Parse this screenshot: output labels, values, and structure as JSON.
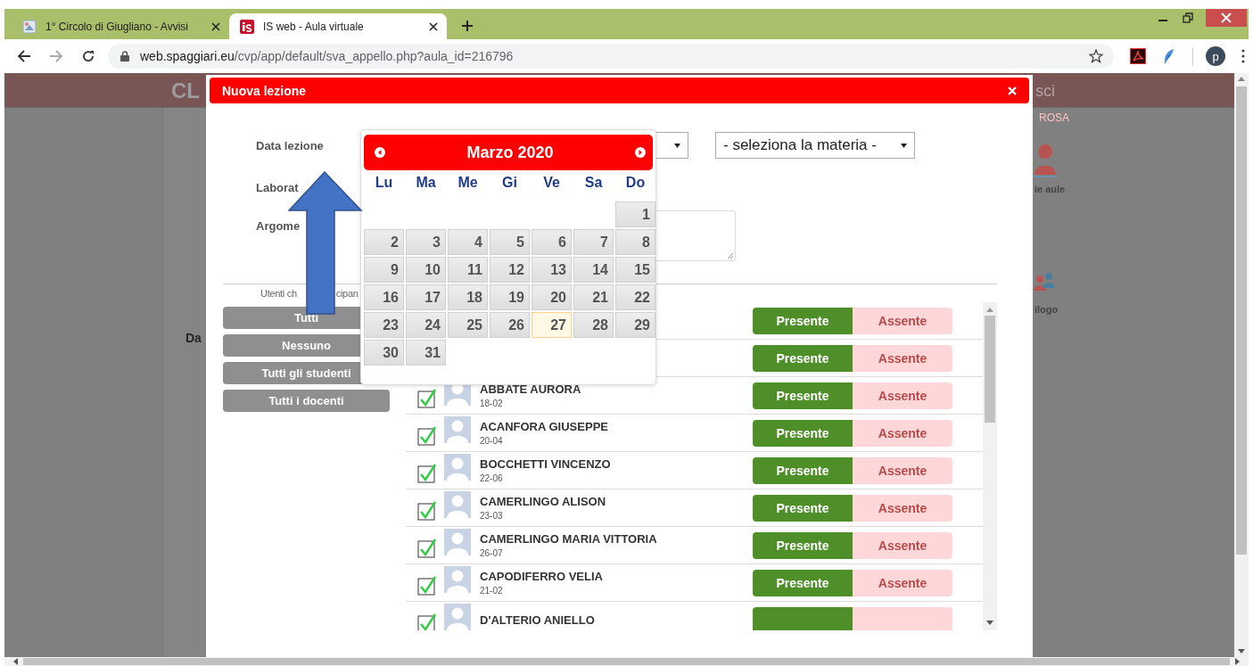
{
  "browser": {
    "tabs": [
      {
        "title": "1° Circolo di Giugliano - Avvisi",
        "selected": false
      },
      {
        "title": "IS web - Aula virtuale",
        "selected": true
      }
    ],
    "address": {
      "host": "web.spaggiari.eu",
      "path": "/cvp/app/default/sva_appello.php?aula_id=216796"
    },
    "profile": "p"
  },
  "background_page": {
    "header_left": "CL",
    "header_right": "sci",
    "user": "ROSA",
    "tile_labels": [
      "ie aule",
      "ilogo"
    ],
    "row_label": "Da"
  },
  "dialog": {
    "title": "Nuova lezione",
    "form": {
      "labels": [
        "Data lezione",
        "Laborat",
        "Argome"
      ],
      "subject_select": "- seleziona la materia -"
    },
    "participants_label": [
      "Utenti ch",
      "cipan"
    ],
    "filter_buttons": [
      {
        "label": "Tutti",
        "disabled": true
      },
      {
        "label": "Nessuno",
        "disabled": true
      },
      {
        "label": "Tutti gli studenti",
        "disabled": true
      },
      {
        "label": "Tutti i docenti",
        "disabled": true
      }
    ],
    "students": [
      {
        "present": true,
        "present_label": "Presente",
        "absent_label": "Assente"
      },
      {
        "present": true,
        "present_label": "Presente",
        "absent_label": "Assente"
      },
      {
        "name": "ABBATE AURORA",
        "date": "18-02",
        "checked": true,
        "present": true,
        "present_label": "Presente",
        "absent_label": "Assente"
      },
      {
        "name": "ACANFORA GIUSEPPE",
        "date": "20-04",
        "checked": true,
        "present": true,
        "present_label": "Presente",
        "absent_label": "Assente"
      },
      {
        "name": "BOCCHETTI VINCENZO",
        "date": "22-06",
        "checked": true,
        "present": true,
        "present_label": "Presente",
        "absent_label": "Assente"
      },
      {
        "name": "CAMERLINGO ALISON",
        "date": "23-03",
        "checked": true,
        "present": true,
        "present_label": "Presente",
        "absent_label": "Assente"
      },
      {
        "name": "CAMERLINGO MARIA VITTORIA",
        "date": "26-07",
        "checked": true,
        "present": true,
        "present_label": "Presente",
        "absent_label": "Assente"
      },
      {
        "name": "CAPODIFERRO VELIA",
        "date": "21-02",
        "checked": true,
        "present": true,
        "present_label": "Presente",
        "absent_label": "Assente"
      },
      {
        "name": "D'ALTERIO ANIELLO",
        "checked": true,
        "present": true
      }
    ]
  },
  "datepicker": {
    "month": "Marzo 2020",
    "weekdays": [
      "Lu",
      "Ma",
      "Me",
      "Gi",
      "Ve",
      "Sa",
      "Do"
    ],
    "weeks": [
      [
        {
          "d": "1",
          "today": false
        }
      ],
      [
        {
          "d": "2",
          "today": false
        },
        {
          "d": "3",
          "today": false
        },
        {
          "d": "4",
          "today": false
        },
        {
          "d": "5",
          "today": false
        },
        {
          "d": "6",
          "today": false
        },
        {
          "d": "7",
          "today": false
        },
        {
          "d": "8",
          "today": false
        }
      ],
      [
        {
          "d": "9",
          "today": false
        },
        {
          "d": "10",
          "today": false
        },
        {
          "d": "11",
          "today": false
        },
        {
          "d": "12",
          "today": false
        },
        {
          "d": "13",
          "today": false
        },
        {
          "d": "14",
          "today": false
        },
        {
          "d": "15",
          "today": false
        }
      ],
      [
        {
          "d": "16",
          "today": false
        },
        {
          "d": "17",
          "today": false
        },
        {
          "d": "18",
          "today": false
        },
        {
          "d": "19",
          "today": false
        },
        {
          "d": "20",
          "today": false
        },
        {
          "d": "21",
          "today": false
        },
        {
          "d": "22",
          "today": false
        }
      ],
      [
        {
          "d": "23",
          "today": false
        },
        {
          "d": "24",
          "today": false
        },
        {
          "d": "25",
          "today": false
        },
        {
          "d": "26",
          "today": false
        },
        {
          "d": "27",
          "today": true
        },
        {
          "d": "28",
          "today": false
        },
        {
          "d": "29",
          "today": false
        }
      ],
      [
        {
          "d": "30",
          "today": false
        },
        {
          "d": "31",
          "today": false
        }
      ]
    ]
  }
}
